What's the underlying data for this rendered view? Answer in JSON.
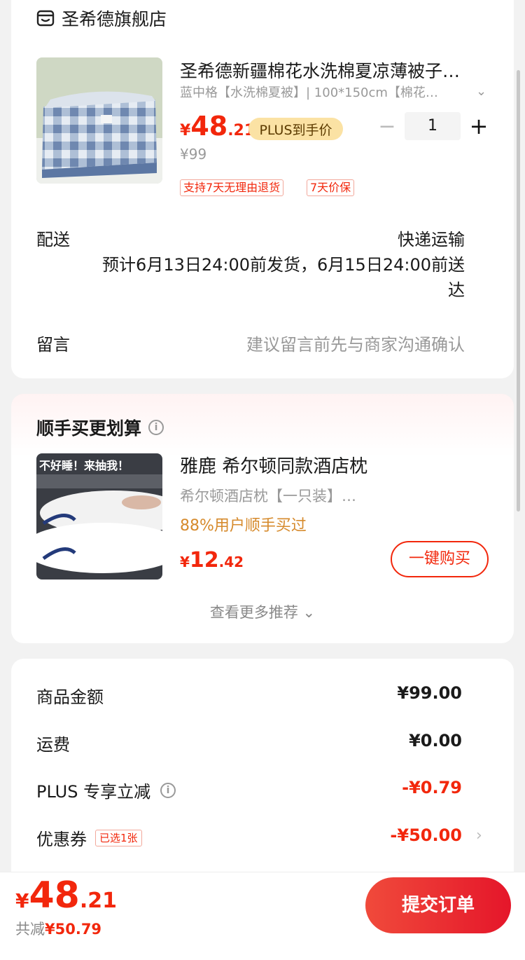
{
  "store": {
    "name": "圣希德旗舰店"
  },
  "product": {
    "title": "圣希德新疆棉花水洗棉夏凉薄被子…",
    "spec": "蓝中格【水洗棉夏被】| 100*150cm【棉花…",
    "price_yen": "¥",
    "price_int": "48",
    "price_dec": ".21",
    "plus_badge": "PLUS到手价",
    "original_price": "¥99",
    "quantity": "1",
    "tags": [
      "支持7天无理由退货",
      "7天价保"
    ]
  },
  "delivery": {
    "label": "配送",
    "method": "快递运输",
    "eta": "预计6月13日24:00前发货，6月15日24:00前送达"
  },
  "message": {
    "label": "留言",
    "placeholder": "建议留言前先与商家沟通确认"
  },
  "recommend": {
    "title": "顺手买更划算",
    "thumb_overlay": "不好睡！来抽我！",
    "name": "雅鹿 希尔顿同款酒店枕",
    "spec": "希尔顿酒店枕【一只装】…",
    "percent": "88%用户顺手买过",
    "price_yen": "¥",
    "price_int": "12",
    "price_dec": ".42",
    "buy_label": "一键购买",
    "more_label": "查看更多推荐"
  },
  "summary": {
    "goods_label": "商品金额",
    "goods_value": "¥99.00",
    "freight_label": "运费",
    "freight_value": "¥0.00",
    "plus_label": "PLUS 专享立减",
    "plus_value": "-¥0.79",
    "coupon_label": "优惠券",
    "coupon_tag": "已选1张",
    "coupon_value": "-¥50.00"
  },
  "footer": {
    "total_yen": "¥",
    "total_int": "48",
    "total_dec": ".21",
    "saved_label": "共减",
    "saved_value": "¥50.79",
    "submit_label": "提交订单"
  },
  "colors": {
    "accent": "#f2270c",
    "plus_badge_bg": "#fbe2a4",
    "recommend_pct": "#d68a2c"
  }
}
